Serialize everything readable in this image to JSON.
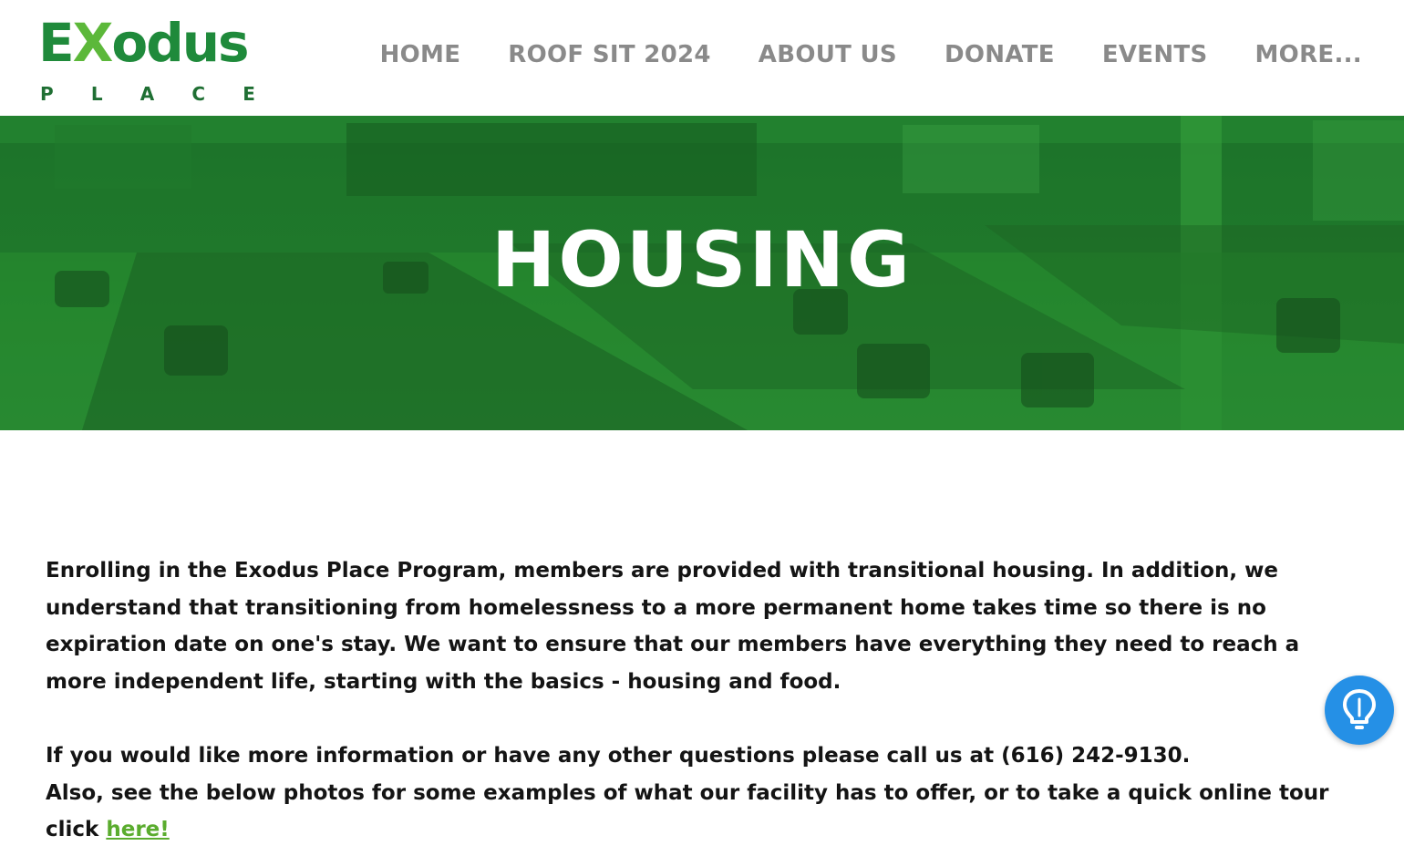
{
  "logo": {
    "word_pre": "E",
    "word_x": "X",
    "word_post": "odus",
    "sub_letters": [
      "P",
      "L",
      "A",
      "C",
      "E"
    ]
  },
  "nav": {
    "items": [
      "HOME",
      "ROOF SIT 2024",
      "ABOUT US",
      "DONATE",
      "EVENTS",
      "MORE..."
    ]
  },
  "hero": {
    "title": "HOUSING"
  },
  "content": {
    "paragraph1": "Enrolling in the Exodus Place Program, members are provided with transitional housing. In addition, we understand that transitioning from homelessness to a more permanent home takes time so there is no expiration date on one's stay. We want to ensure that our members have everything they need to reach a more independent life, starting with the basics - housing and food.",
    "paragraph2": "If you would like more information or have any other questions please call us at (616) 242-9130.",
    "paragraph3_text": "Also, see the below photos for some examples of what our facility has to offer, or to take a quick online tour click ",
    "paragraph3_link": "here!"
  },
  "help_button": {
    "icon": "lightbulb-icon"
  },
  "colors": {
    "brand_green": "#1f8a3b",
    "accent_green": "#5cb83a",
    "hero_green": "#26892f",
    "nav_gray": "#8a8a8a",
    "help_blue": "#2590e6",
    "link_green": "#5aac2e"
  }
}
